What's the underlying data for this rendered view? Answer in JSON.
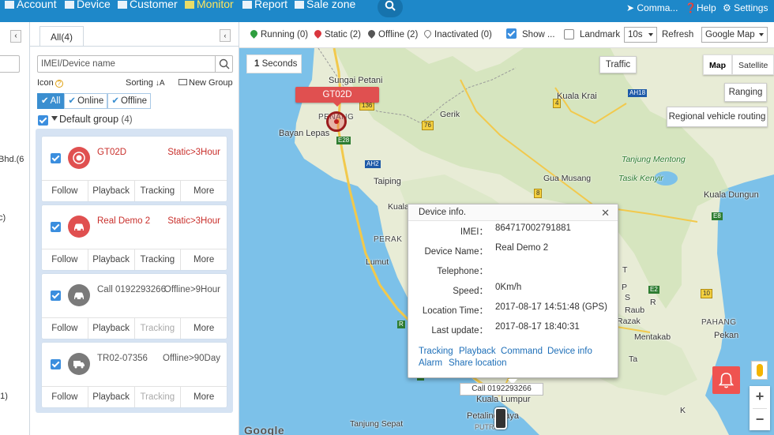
{
  "nav": {
    "items": [
      {
        "label": "Account",
        "icon": "account-icon"
      },
      {
        "label": "Device",
        "icon": "device-icon"
      },
      {
        "label": "Customer",
        "icon": "customer-icon"
      },
      {
        "label": "Monitor",
        "icon": "monitor-icon",
        "active": true
      },
      {
        "label": "Report",
        "icon": "report-icon"
      },
      {
        "label": "Sale zone",
        "icon": "sale-zone-icon"
      }
    ],
    "right": {
      "command": "Comma...",
      "help": "Help",
      "settings": "Settings"
    }
  },
  "leftmost": {
    "chevron": "‹",
    "texts": [
      "Bhd.(6",
      "c)",
      "'1)"
    ]
  },
  "panel": {
    "tab_all": "All(4)",
    "collapse": "‹",
    "search_placeholder": "IMEI/Device name",
    "icon_label": "Icon",
    "sorting_label": "Sorting",
    "new_group": "New Group",
    "filters": [
      "All",
      "Online",
      "Offline"
    ],
    "group_name": "Default group",
    "group_count": "(4)",
    "devices": [
      {
        "name": "GT02D",
        "status": "Static>3Hour",
        "state": "static",
        "actions": [
          "Follow",
          "Playback",
          "Tracking",
          "More"
        ],
        "tracking_enabled": true
      },
      {
        "name": "Real Demo 2",
        "status": "Static>3Hour",
        "state": "static",
        "actions": [
          "Follow",
          "Playback",
          "Tracking",
          "More"
        ],
        "tracking_enabled": true
      },
      {
        "name": "Call 0192293266",
        "status": "Offline>9Hour",
        "state": "offline",
        "actions": [
          "Follow",
          "Playback",
          "Tracking",
          "More"
        ],
        "tracking_enabled": false
      },
      {
        "name": "TR02-07356",
        "status": "Offline>90Day",
        "state": "offline",
        "actions": [
          "Follow",
          "Playback",
          "Tracking",
          "More"
        ],
        "tracking_enabled": false
      }
    ]
  },
  "status": {
    "running": "Running (0)",
    "static": "Static (2)",
    "offline": "Offline (2)",
    "inactivated": "Inactivated (0)",
    "show": "Show ...",
    "landmark": "Landmark",
    "refresh_value": "10s",
    "refresh_label": "Refresh",
    "map_provider": "Google Map",
    "colors": {
      "running": "#2e9e3e",
      "static": "#d9363e",
      "offline": "#555555",
      "inactivated": "#777777"
    }
  },
  "map": {
    "seconds_value": "1",
    "seconds_label": "Seconds",
    "traffic": "Traffic",
    "map_type": [
      "Map",
      "Satellite"
    ],
    "ranging": "Ranging",
    "regional": "Regional vehicle routing",
    "device_label": "GT02D",
    "call_tag": "Call 0192293266",
    "google": "Google",
    "labels": [
      "Sungai Petani",
      "Bayan Lepas",
      "PENANG",
      "Gerik",
      "Kuala Krai",
      "Taiping",
      "Gua Musang",
      "Kuala Dungun",
      "Kuala",
      "Lumut",
      "PERAK",
      "PAHANG",
      "Raub",
      "Razak",
      "Pekan",
      "Mentakab",
      "Kuala Lumpur",
      "Petaling Jaya",
      "Tanjung Sepat",
      "Tasik Kenyir",
      "Tanjung Mentong",
      "PUTRA",
      "K",
      "T",
      "P",
      "S",
      "R",
      "Ta"
    ],
    "shields": [
      "136",
      "E1",
      "76",
      "E28",
      "AH2",
      "AH18",
      "4",
      "8",
      "E8",
      "E2",
      "10",
      "R",
      "E"
    ]
  },
  "popup": {
    "title": "Device info.",
    "close": "✕",
    "rows": [
      {
        "label": "IMEI：",
        "value": "864717002791881"
      },
      {
        "label": "Device Name：",
        "value": "Real Demo 2"
      },
      {
        "label": "Telephone：",
        "value": ""
      },
      {
        "label": "Speed：",
        "value": "0Km/h"
      },
      {
        "label": "Location Time：",
        "value": "2017-08-17 14:51:48 (GPS)"
      },
      {
        "label": "Last update：",
        "value": "2017-08-17 18:40:31"
      }
    ],
    "links": [
      "Tracking",
      "Playback",
      "Command",
      "Device info",
      "Alarm",
      "Share location"
    ]
  },
  "controls": {
    "zoom_in": "+",
    "zoom_out": "−"
  }
}
